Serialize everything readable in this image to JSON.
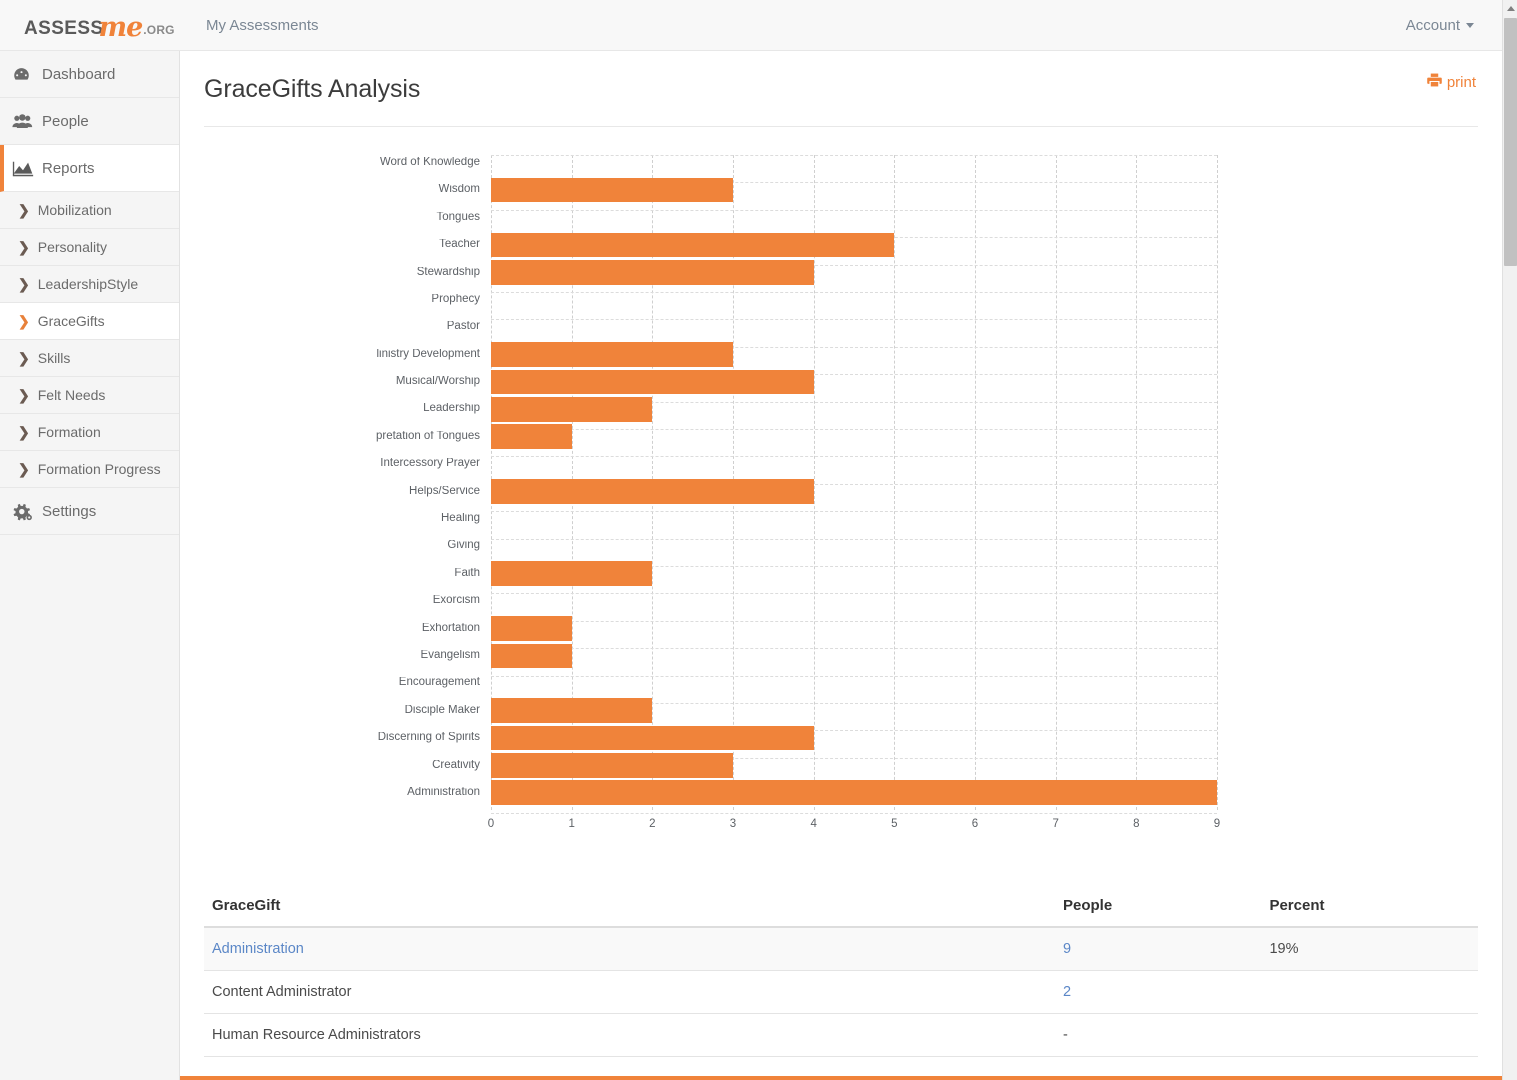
{
  "navbar": {
    "brand": {
      "part1": "ASSESS",
      "part2": "me",
      "part3": ".ORG"
    },
    "links": [
      {
        "label": "My Assessments",
        "name": "nav-my-assessments"
      }
    ],
    "account_label": "Account"
  },
  "sidebar": {
    "items": [
      {
        "label": "Dashboard",
        "icon": "dashboard-icon",
        "active": false
      },
      {
        "label": "People",
        "icon": "people-icon",
        "active": false
      },
      {
        "label": "Reports",
        "icon": "reports-icon",
        "active": true
      }
    ],
    "sub_items": [
      {
        "label": "Mobilization",
        "active": false
      },
      {
        "label": "Personality",
        "active": false
      },
      {
        "label": "LeadershipStyle",
        "active": false
      },
      {
        "label": "GraceGifts",
        "active": true
      },
      {
        "label": "Skills",
        "active": false
      },
      {
        "label": "Felt Needs",
        "active": false
      },
      {
        "label": "Formation",
        "active": false
      },
      {
        "label": "Formation Progress",
        "active": false
      }
    ],
    "settings": {
      "label": "Settings",
      "icon": "gear-icon"
    }
  },
  "page": {
    "title": "GraceGifts Analysis",
    "print_label": "print"
  },
  "chart_data": {
    "type": "bar",
    "orientation": "horizontal",
    "title": "GraceGifts Analysis",
    "xlabel": "",
    "ylabel": "",
    "xlim": [
      0,
      9
    ],
    "xticks": [
      "0",
      "1",
      "2",
      "3",
      "4",
      "5",
      "6",
      "7",
      "8",
      "9"
    ],
    "grid": true,
    "legend": "none",
    "bar_color": "#F0833A",
    "categories": [
      "Word of Knowledge",
      "Wisdom",
      "Tongues",
      "Teacher",
      "Stewardship",
      "Prophecy",
      "Pastor",
      "Ministry Development",
      "Musical/Worship",
      "Leadership",
      "Interpretation of Tongues",
      "Intercessory Prayer",
      "Helps/Service",
      "Healing",
      "Giving",
      "Faith",
      "Exorcism",
      "Exhortation",
      "Evangelism",
      "Encouragement",
      "Disciple Maker",
      "Discerning of Spirits",
      "Creativity",
      "Administration"
    ],
    "display_labels": [
      "Word of Knowledge",
      "Wisdom",
      "Tongues",
      "Teacher",
      "Stewardship",
      "Prophecy",
      "Pastor",
      "linistry Development",
      "Musical/Worship",
      "Leadership",
      "pretation of Tongues",
      "Intercessory Prayer",
      "Helps/Service",
      "Healing",
      "Giving",
      "Faith",
      "Exorcism",
      "Exhortation",
      "Evangelism",
      "Encouragement",
      "Disciple Maker",
      "Discerning of Spirits",
      "Creativity",
      "Administration"
    ],
    "values": [
      0,
      3,
      0,
      5,
      4,
      0,
      0,
      3,
      4,
      2,
      1,
      0,
      4,
      0,
      0,
      2,
      0,
      1,
      1,
      0,
      2,
      4,
      3,
      9
    ]
  },
  "table": {
    "headers": {
      "name": "GraceGift",
      "people": "People",
      "percent": "Percent"
    },
    "rows": [
      {
        "name": "Administration",
        "people": "9",
        "percent": "19%",
        "link": true,
        "indent": 0,
        "striped": true
      },
      {
        "name": "Content Administrator",
        "people": "2",
        "percent": "",
        "link": false,
        "indent": 1,
        "striped": false
      },
      {
        "name": "Human Resource Administrators",
        "people": "-",
        "percent": "",
        "link": false,
        "indent": 1,
        "striped": false
      }
    ]
  }
}
